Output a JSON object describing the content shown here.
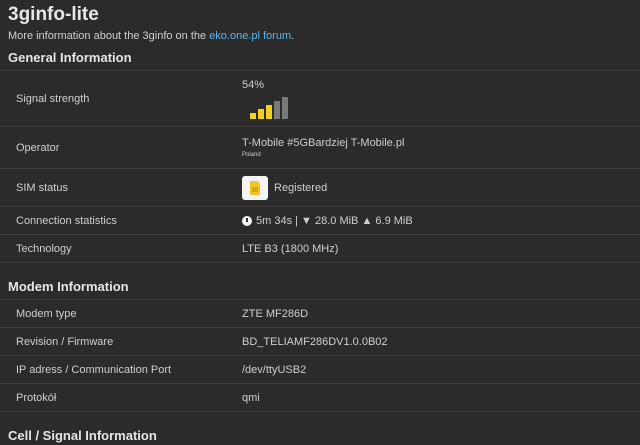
{
  "app": {
    "title": "3ginfo-lite",
    "subtitle_prefix": "More information about the 3ginfo on the ",
    "subtitle_link": "eko.one.pl forum",
    "subtitle_suffix": "."
  },
  "sections": {
    "general": {
      "title": "General Information",
      "signal": {
        "label": "Signal strength",
        "percent_text": "54%",
        "level": 0.54,
        "bars_active": 3,
        "bars_total": 5,
        "active_color": "#f3d11a",
        "inactive_color": "#7a7a7a"
      },
      "operator": {
        "label": "Operator",
        "name": "T-Mobile #5GBardziej T-Mobile.pl",
        "country": "Poland"
      },
      "sim": {
        "label": "SIM status",
        "value": "Registered",
        "icon": "sim-card-icon"
      },
      "connection": {
        "label": "Connection statistics",
        "value": "5m 34s | ▼ 28.0 MiB ▲ 6.9 MiB",
        "icon": "stopwatch-icon"
      },
      "technology": {
        "label": "Technology",
        "value": "LTE B3 (1800 MHz)"
      }
    },
    "modem": {
      "title": "Modem Information",
      "rows": [
        {
          "label": "Modem type",
          "value": "ZTE MF286D"
        },
        {
          "label": "Revision / Firmware",
          "value": "BD_TELIAMF286DV1.0.0B02"
        },
        {
          "label": "IP adress / Communication Port",
          "value": "/dev/ttyUSB2"
        },
        {
          "label": "Protokół",
          "value": "qmi"
        }
      ]
    },
    "cell": {
      "title": "Cell / Signal Information"
    }
  },
  "colors": {
    "background": "#2b2b2b",
    "link": "#5bb7e8",
    "text": "#cfcfcf",
    "sim_yellow": "#f2c523"
  }
}
